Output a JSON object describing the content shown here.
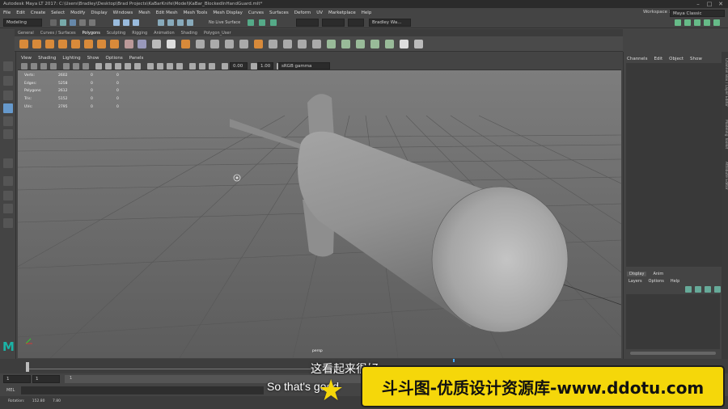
{
  "window": {
    "title": "Autodesk Maya LT 2017: C:\\Users\\Bradley\\Desktop\\Brad Projects\\KaBarKnife\\Model\\KaBar_BlockedInHandGuard.mlt*",
    "controls": [
      "–",
      "□",
      "✕"
    ]
  },
  "menubar": {
    "items": [
      "File",
      "Edit",
      "Create",
      "Select",
      "Modify",
      "Display",
      "Windows",
      "Mesh",
      "Edit Mesh",
      "Mesh Tools",
      "Mesh Display",
      "Curves",
      "Surfaces",
      "Deform",
      "UV",
      "Marketplace",
      "Help"
    ],
    "workspace_label": "Workspace :",
    "workspace_value": "Maya Classic"
  },
  "statusline": {
    "mode": "Modeling",
    "live_surface": "No Live Surface",
    "user": "Bradley Wa..."
  },
  "shelf": {
    "tabs": [
      "General",
      "Curves / Surfaces",
      "Polygons",
      "Sculpting",
      "Rigging",
      "Animation",
      "Shading",
      "Polygon_User"
    ],
    "active_tab": "Polygons"
  },
  "panel": {
    "menu": [
      "View",
      "Shading",
      "Lighting",
      "Show",
      "Options",
      "Panels"
    ],
    "field_a": "0.00",
    "field_b": "1.00",
    "colorspace": "sRGB gamma",
    "camera": "persp"
  },
  "hud": {
    "rows": [
      {
        "label": "Verts:",
        "value": "2602",
        "sel": "0",
        "extra": "0"
      },
      {
        "label": "Edges:",
        "value": "5258",
        "sel": "0",
        "extra": "0"
      },
      {
        "label": "Polygons:",
        "value": "2612",
        "sel": "0",
        "extra": "0"
      },
      {
        "label": "Tris:",
        "value": "5152",
        "sel": "0",
        "extra": "0"
      },
      {
        "label": "UVs:",
        "value": "2795",
        "sel": "0",
        "extra": "0"
      }
    ]
  },
  "channel_box": {
    "menu": [
      "Channels",
      "Edit",
      "Object",
      "Show"
    ],
    "side_tabs": [
      "Channel Box / Layer Editor",
      "Modeling Toolkit",
      "Attribute Editor"
    ]
  },
  "layer_editor": {
    "tabs": [
      "Display",
      "Anim"
    ],
    "menu": [
      "Layers",
      "Options",
      "Help"
    ]
  },
  "range": {
    "start": "1",
    "start2": "1",
    "marker": "1"
  },
  "mel": {
    "label": "MEL"
  },
  "helpline": {
    "rotation_label": "Rotation:",
    "rotation_a": "152.80",
    "rotation_b": "7.80"
  },
  "subtitles": {
    "cn": "这看起来很好",
    "en": "So that's good"
  },
  "watermark": {
    "text": "斗斗图-优质设计资源库-www.ddotu.com"
  },
  "logo": {
    "letter": "M"
  },
  "colors": {
    "accent_shelf": "#d88a3a",
    "banner_yellow": "#f5d70a",
    "maya_logo": "#1ab3a6"
  }
}
